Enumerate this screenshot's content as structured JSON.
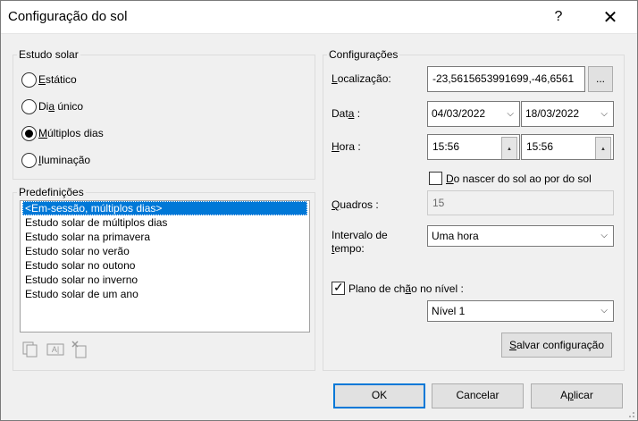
{
  "window": {
    "title": "Configuração do sol",
    "help_glyph": "?",
    "close_glyph": "✕"
  },
  "solar_study": {
    "legend": "Estudo solar",
    "options": [
      {
        "pre": "",
        "mnemonic": "E",
        "post": "stático",
        "checked": false
      },
      {
        "pre": "Di",
        "mnemonic": "a",
        "post": " único",
        "checked": false
      },
      {
        "pre": "",
        "mnemonic": "M",
        "post": "últiplos dias",
        "checked": true
      },
      {
        "pre": "",
        "mnemonic": "I",
        "post": "luminação",
        "checked": false
      }
    ]
  },
  "presets": {
    "legend": "Predefinições",
    "items": [
      "<Em-sessão, múltiplos dias>",
      "Estudo solar de múltiplos dias",
      "Estudo solar na primavera",
      "Estudo solar no verão",
      "Estudo solar no outono",
      "Estudo solar no inverno",
      "Estudo solar de um ano"
    ],
    "selected_index": 0,
    "icons": [
      "duplicate-icon",
      "rename-icon",
      "delete-icon"
    ],
    "rename_glyph": "A|"
  },
  "settings": {
    "legend": "Configurações",
    "location_label": {
      "pre": "",
      "mnemonic": "L",
      "post": "ocalização:"
    },
    "location_value": "-23,5615653991699,-46,6561",
    "browse_label": "...",
    "date_label": {
      "pre": "Dat",
      "mnemonic": "a",
      "post": " :"
    },
    "date_start": "04/03/2022",
    "date_end": "18/03/2022",
    "time_label": {
      "pre": "",
      "mnemonic": "H",
      "post": "ora :"
    },
    "time_start": "15:56",
    "time_end": "15:56",
    "sunrise_label": {
      "pre": "",
      "mnemonic": "D",
      "post": "o nascer do sol ao por do sol"
    },
    "sunrise_checked": false,
    "frames_label": {
      "pre": "",
      "mnemonic": "Q",
      "post": "uadros :"
    },
    "frames_value": "15",
    "interval_label_line1": "Intervalo de",
    "interval_label_line2": {
      "pre": "",
      "mnemonic": "t",
      "post": "empo:"
    },
    "interval_value": "Uma hora",
    "ground_plane_label": {
      "pre": "Plano de ch",
      "mnemonic": "ã",
      "post": "o no nível :"
    },
    "ground_plane_checked": true,
    "level_value": "Nível 1",
    "save_label": {
      "pre": "",
      "mnemonic": "S",
      "post": "alvar configuração"
    }
  },
  "footer": {
    "ok": "OK",
    "cancel": "Cancelar",
    "apply": {
      "pre": "A",
      "mnemonic": "p",
      "post": "licar"
    }
  }
}
